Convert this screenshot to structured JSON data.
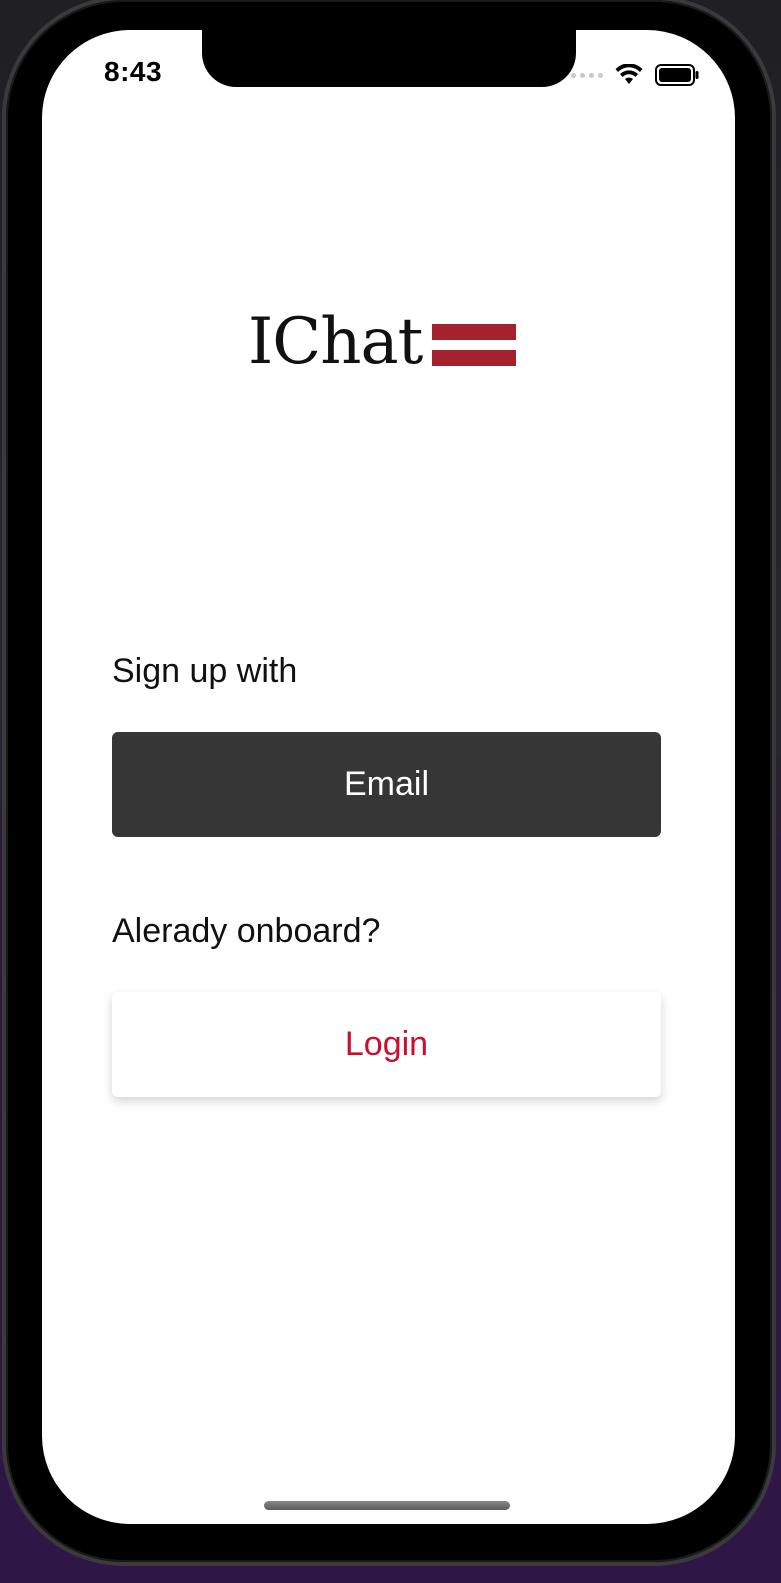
{
  "status_bar": {
    "time": "8:43",
    "signal_icon": "signal-dots-icon",
    "wifi_icon": "wifi-icon",
    "battery_icon": "battery-icon"
  },
  "logo": {
    "text": "IChat",
    "mark_icon": "double-bar-mark",
    "mark_color": "#a3222e"
  },
  "signup": {
    "label": "Sign up with",
    "email_button": "Email"
  },
  "login_section": {
    "label": "Alerady onboard?",
    "login_button": "Login"
  },
  "colors": {
    "email_button_bg": "#363636",
    "login_text": "#c8102e"
  }
}
